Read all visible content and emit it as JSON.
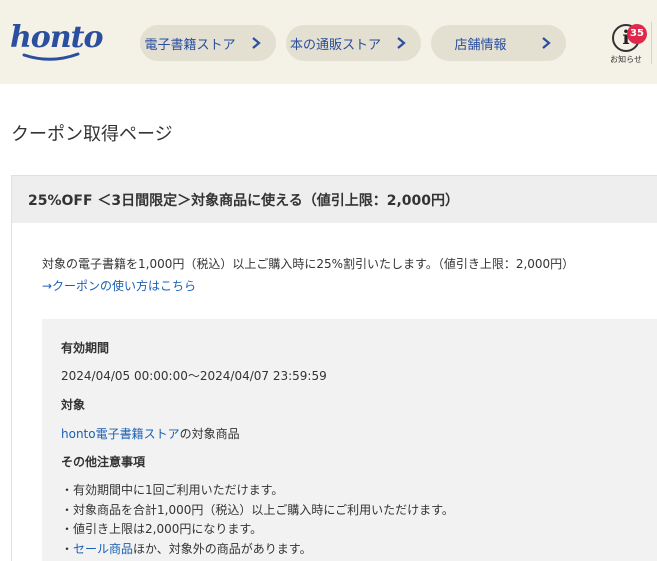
{
  "header": {
    "logo": "honto",
    "nav": [
      {
        "label": "電子書籍ストア"
      },
      {
        "label": "本の通販ストア"
      },
      {
        "label": "店舗情報"
      }
    ],
    "notifications": {
      "count": "35",
      "label": "お知らせ"
    }
  },
  "page": {
    "title": "クーポン取得ページ"
  },
  "coupon": {
    "heading": "25%OFF ＜3日間限定＞対象商品に使える（値引上限：2,000円）",
    "description": "対象の電子書籍を1,000円（税込）以上ご購入時に25%割引いたします。（値引き上限：2,000円）",
    "howto_link": "→クーポンの使い方はこちら",
    "validity_label": "有効期間",
    "validity_value": "2024/04/05 00:00:00～2024/04/07 23:59:59",
    "target_label": "対象",
    "target_link": "honto電子書籍ストア",
    "target_suffix": "の対象商品",
    "notes_label": "その他注意事項",
    "notes": [
      "・有効期間中に1回ご利用いただけます。",
      "・対象商品を合計1,000円（税込）以上ご購入時にご利用いただけます。",
      "・値引き上限は2,000円になります。"
    ],
    "note_sale_prefix": "・",
    "note_sale_link": "セール商品",
    "note_sale_suffix": "ほか、対象外の商品があります。"
  },
  "colors": {
    "header_bg": "#f4f1e6",
    "link": "#1a5fb4",
    "badge": "#e0294a",
    "logo": "#2a4f9e"
  }
}
